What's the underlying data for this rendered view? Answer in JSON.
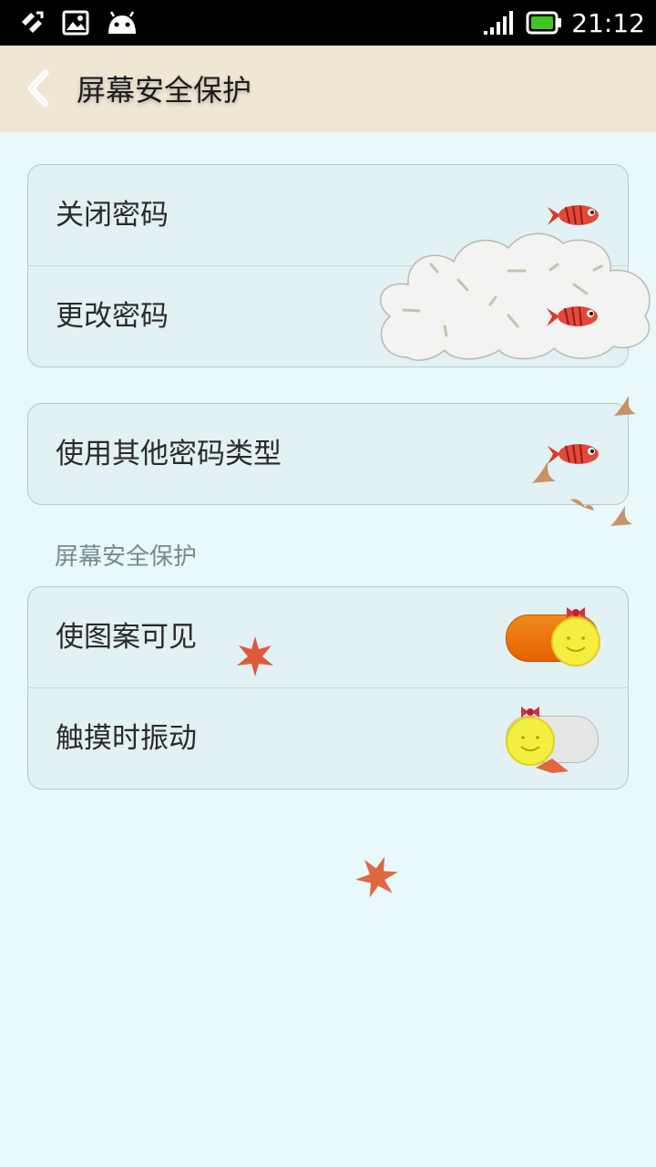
{
  "status_bar": {
    "time": "21:12",
    "icons": [
      "usb-debug-icon",
      "image-icon",
      "android-icon",
      "signal-icon",
      "battery-icon"
    ],
    "battery_color": "#3fc51e"
  },
  "header": {
    "title": "屏幕安全保护",
    "back_icon": "chevron-left-icon"
  },
  "group1": {
    "items": [
      {
        "label": "关闭密码"
      },
      {
        "label": "更改密码"
      }
    ]
  },
  "group2": {
    "items": [
      {
        "label": "使用其他密码类型"
      }
    ]
  },
  "section": {
    "title": "屏幕安全保护"
  },
  "group3": {
    "items": [
      {
        "label": "使图案可见",
        "on": true
      },
      {
        "label": "触摸时振动",
        "on": false
      }
    ]
  },
  "colors": {
    "accent": "#e56100",
    "background": "#e9f8fb",
    "header_bg": "#efe7d3"
  }
}
